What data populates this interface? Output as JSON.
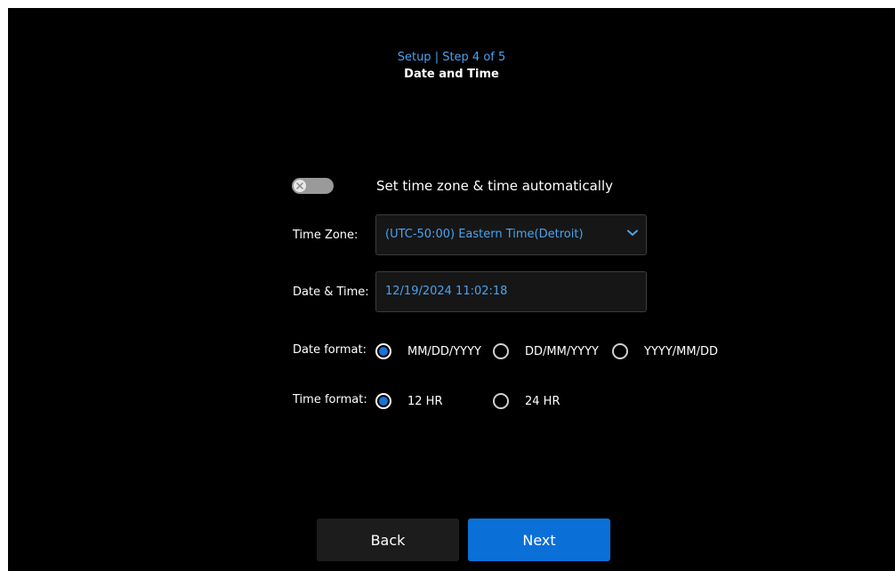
{
  "header": {
    "step": "Setup | Step 4 of 5",
    "title": "Date and Time"
  },
  "auto_setting": {
    "label": "Set time zone & time automatically",
    "enabled": false
  },
  "time_zone": {
    "label": "Time Zone:",
    "value": "(UTC-50:00) Eastern Time(Detroit)"
  },
  "date_time": {
    "label": "Date & Time:",
    "value": "12/19/2024 11:02:18"
  },
  "date_format": {
    "label": "Date format:",
    "options": [
      "MM/DD/YYYY",
      "DD/MM/YYYY",
      "YYYY/MM/DD"
    ],
    "selected": "MM/DD/YYYY"
  },
  "time_format": {
    "label": "Time format:",
    "options": [
      "12 HR",
      "24 HR"
    ],
    "selected": "12 HR"
  },
  "buttons": {
    "back": "Back",
    "next": "Next"
  },
  "colors": {
    "accent": "#4aa3ef",
    "primary_button": "#0b6fd8",
    "radio_selected": "#1a73d9",
    "background": "#000000"
  }
}
